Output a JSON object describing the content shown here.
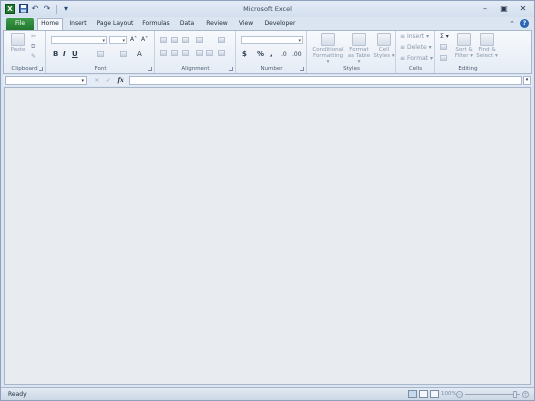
{
  "window": {
    "title": "Microsoft Excel",
    "controls": {
      "minimize": "–",
      "restore": "▣",
      "close": "✕"
    }
  },
  "app_icon": {
    "letter": "X"
  },
  "qat": {
    "save": "💾",
    "undo": "↶",
    "redo": "↷",
    "customize": "▾"
  },
  "tabs": {
    "file": "File",
    "items": [
      "Home",
      "Insert",
      "Page Layout",
      "Formulas",
      "Data",
      "Review",
      "View",
      "Developer"
    ],
    "active": "Home"
  },
  "ribbon": {
    "clipboard": {
      "label": "Clipboard",
      "paste": "Paste"
    },
    "font": {
      "label": "Font",
      "bold": "B",
      "italic": "I",
      "underline": "U",
      "grow": "A˄",
      "shrink": "A˅",
      "font_color": "A"
    },
    "alignment": {
      "label": "Alignment"
    },
    "number": {
      "label": "Number",
      "currency": "$",
      "percent": "%",
      "comma": ",",
      "inc_dec": ".0",
      "dec_dec": ".00"
    },
    "styles": {
      "label": "Styles",
      "conditional": [
        "Conditional",
        "Formatting ▾"
      ],
      "format_table": [
        "Format",
        "as Table ▾"
      ],
      "cell_styles": [
        "Cell",
        "Styles ▾"
      ]
    },
    "cells": {
      "label": "Cells",
      "insert": "Insert ▾",
      "delete": "Delete ▾",
      "format": "Format ▾"
    },
    "editing": {
      "label": "Editing",
      "autosum": "Σ ▾",
      "sort": [
        "Sort &",
        "Filter ▾"
      ],
      "find": [
        "Find &",
        "Select ▾"
      ]
    }
  },
  "formula_bar": {
    "fx": "fx",
    "cancel": "×",
    "enter": "✓"
  },
  "status_bar": {
    "ready": "Ready",
    "zoom": "100%",
    "zoom_minus": "−",
    "zoom_plus": "+"
  },
  "colors": {
    "file_tab": "#2a8a37",
    "ribbon": "#eef2f8",
    "workspace": "#e8ecf1"
  }
}
